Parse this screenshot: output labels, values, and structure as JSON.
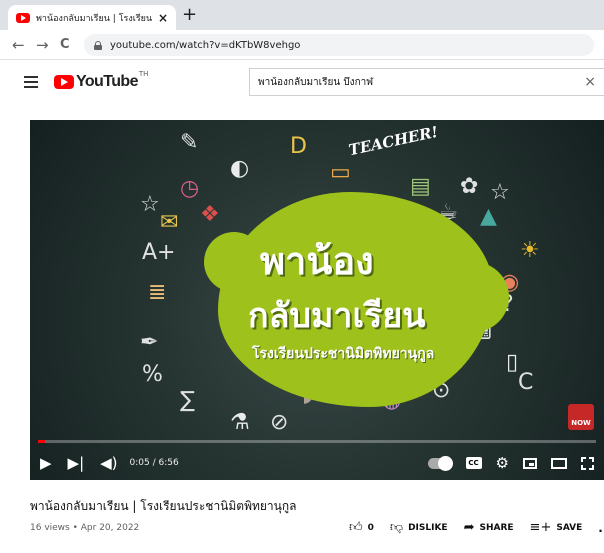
{
  "browser": {
    "tab_title": "พาน้องกลับมาเรียน | โรงเรียนประชานิมิ",
    "tab_close": "×",
    "new_tab": "+",
    "back": "←",
    "forward": "→",
    "reload": "C",
    "url": "youtube.com/watch?v=dKTbW8vehgo"
  },
  "youtube": {
    "logo_text": "YouTube",
    "logo_tm": "TH",
    "search_value": "พาน้องกลับมาเรียน บึงกาฬ",
    "search_clear": "×"
  },
  "video": {
    "thumbnail_line1": "พาน้อง",
    "thumbnail_line2": "กลับมาเรียน",
    "thumbnail_subtitle": "โรงเรียนประชานิมิตพิทยานุกูล",
    "thumbnail_corner_text": "TEACHER!",
    "badge_text": "NOW",
    "time": "0:05 / 6:56",
    "progress_fraction": 0.012,
    "cc_label": "CC"
  },
  "info": {
    "title": "พาน้องกลับมาเรียน | โรงเรียนประชานิมิตพิทยานุกูล",
    "meta": "16 views • Apr 20, 2022",
    "like_count": "0",
    "dislike": "DISLIKE",
    "share": "SHARE",
    "save": "SAVE",
    "more": "..."
  },
  "colors": {
    "accent": "#ff0000",
    "thumbnail_green": "#9ec11c"
  }
}
